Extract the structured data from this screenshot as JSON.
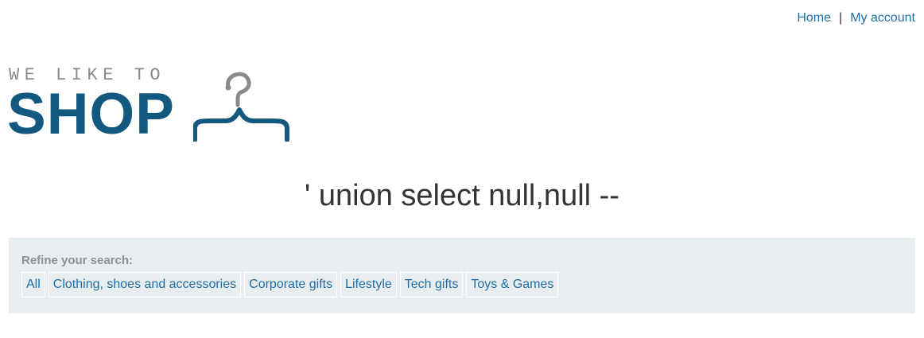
{
  "nav": {
    "home_label": "Home",
    "separator": "|",
    "account_label": "My account"
  },
  "logo": {
    "tagline": "WE LIKE TO",
    "name": "SHOP",
    "icon": "hanger-icon",
    "colors": {
      "tagline": "#8a8a8a",
      "name": "#13587f",
      "hanger_top": "#8a8a8a",
      "hanger_bottom": "#13587f"
    }
  },
  "search": {
    "title": "' union select null,null --"
  },
  "filters": {
    "label": "Refine your search:",
    "tags": [
      {
        "label": "All"
      },
      {
        "label": "Clothing, shoes and accessories"
      },
      {
        "label": "Corporate gifts"
      },
      {
        "label": "Lifestyle"
      },
      {
        "label": "Tech gifts"
      },
      {
        "label": "Toys & Games"
      }
    ]
  },
  "colors": {
    "link": "#1f6ea4",
    "panel_bg": "#e8edf0",
    "text": "#333333"
  }
}
